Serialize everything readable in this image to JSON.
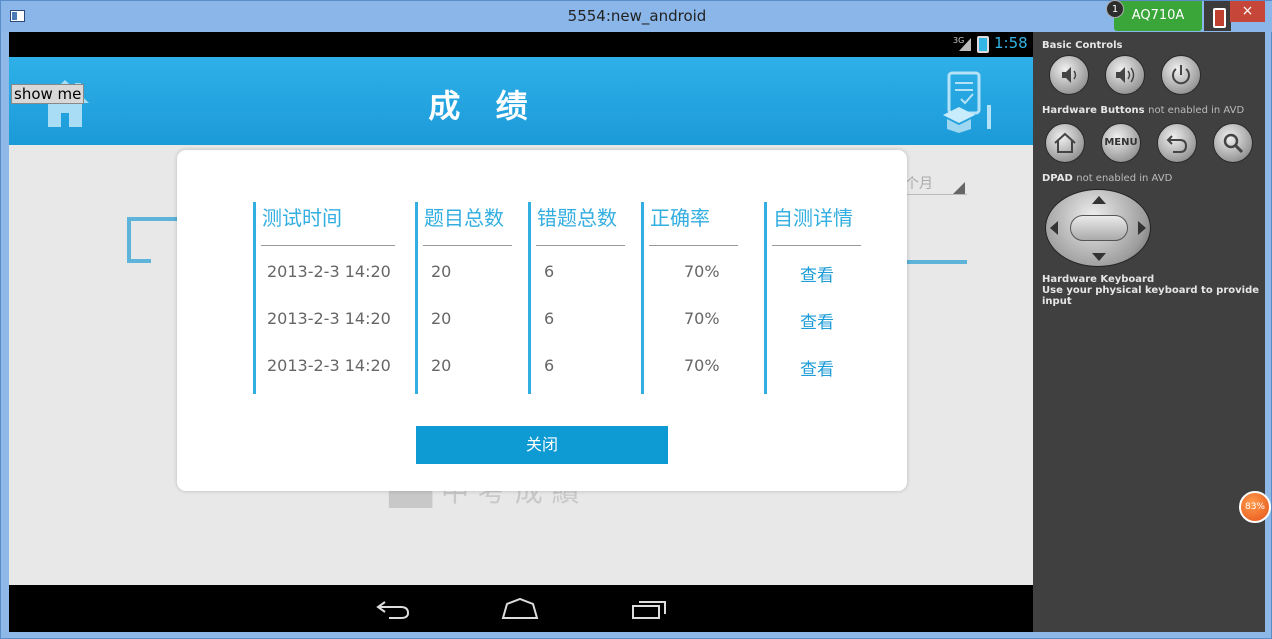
{
  "window": {
    "title": "5554:new_android",
    "close_label": "×",
    "avd_name": "AQ710A",
    "avd_badge": "1"
  },
  "statusbar": {
    "network": "3G",
    "clock": "1:58"
  },
  "appbar": {
    "title": "成 绩",
    "debug_button": "show me"
  },
  "background": {
    "month_label": "个月",
    "logo_text": "▇▇ 中 考 成 績"
  },
  "dialog": {
    "columns": [
      "测试时间",
      "题目总数",
      "错题总数",
      "正确率",
      "自测详情"
    ],
    "rows": [
      {
        "time": "2013-2-3 14:20",
        "total": "20",
        "wrong": "6",
        "rate": "70%",
        "detail": "查看"
      },
      {
        "time": "2013-2-3 14:20",
        "total": "20",
        "wrong": "6",
        "rate": "70%",
        "detail": "查看"
      },
      {
        "time": "2013-2-3 14:20",
        "total": "20",
        "wrong": "6",
        "rate": "70%",
        "detail": "查看"
      }
    ],
    "close_button": "关闭"
  },
  "side_panel": {
    "basic_controls": "Basic Controls",
    "hardware_buttons": "Hardware Buttons",
    "hardware_buttons_note": "not enabled in AVD",
    "menu_label": "MENU",
    "dpad": "DPAD",
    "dpad_note": "not enabled in AVD",
    "keyboard_title": "Hardware Keyboard",
    "keyboard_note": "Use your physical keyboard to provide input"
  },
  "overlay_badge": "83%",
  "colors": {
    "accent": "#33aee0",
    "button": "#0e9ad3",
    "appbar": "#1b9ad8",
    "clock": "#33b5e5"
  }
}
